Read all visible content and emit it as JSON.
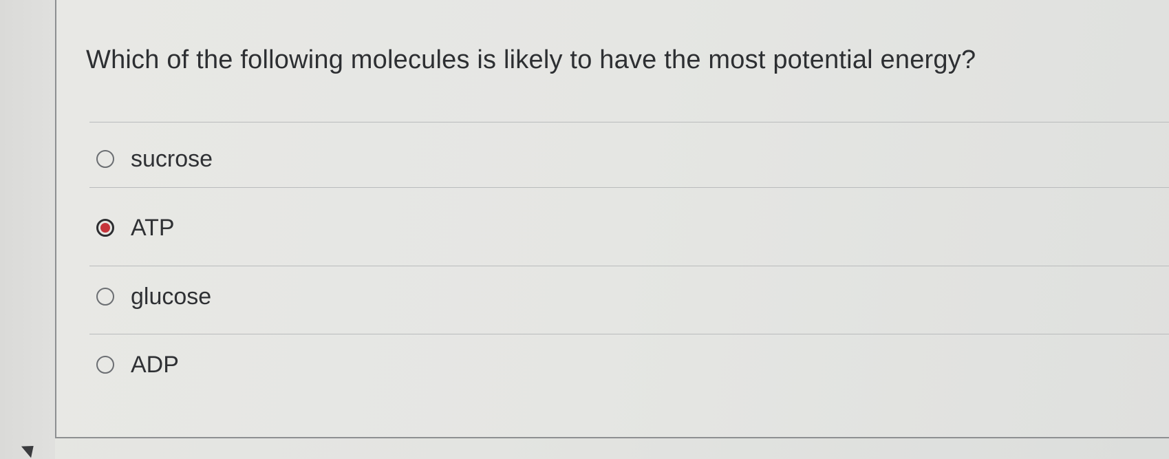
{
  "question": {
    "text": "Which of the following molecules is likely to have the most potential energy?"
  },
  "options": [
    {
      "label": "sucrose",
      "selected": false
    },
    {
      "label": "ATP",
      "selected": true
    },
    {
      "label": "glucose",
      "selected": false
    },
    {
      "label": "ADP",
      "selected": false
    }
  ],
  "colors": {
    "selected_radio": "#c6343b",
    "text": "#2d2f32",
    "divider": "#b9bbbc"
  }
}
